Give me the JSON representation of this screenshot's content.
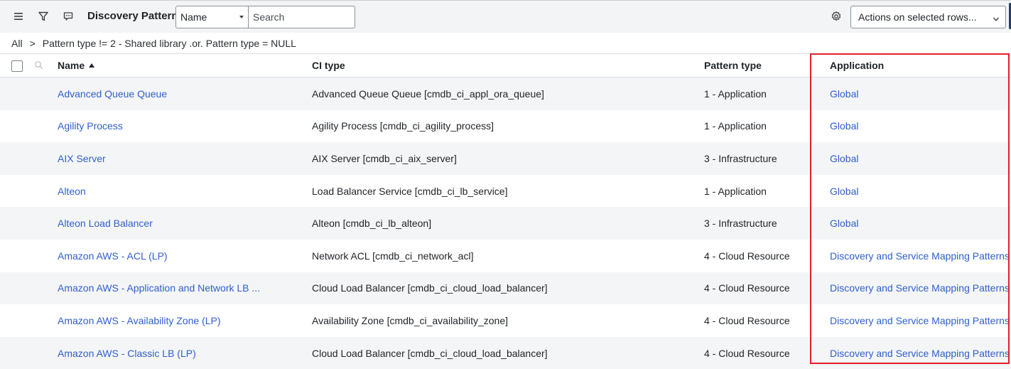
{
  "header": {
    "title": "Discovery Patterns",
    "field_select_value": "Name",
    "search_placeholder": "Search",
    "actions_select_value": "Actions on selected rows...",
    "icons": [
      "menu-icon",
      "filter-icon",
      "comment-icon",
      "gear-icon"
    ]
  },
  "breadcrumb": {
    "root": "All",
    "separator": ">",
    "condition": "Pattern type != 2 - Shared library .or. Pattern type = NULL"
  },
  "columns": {
    "name": "Name",
    "ci_type": "CI type",
    "pattern_type": "Pattern type",
    "application": "Application"
  },
  "rows": [
    {
      "name": "Advanced Queue Queue",
      "ci_type": "Advanced Queue Queue [cmdb_ci_appl_ora_queue]",
      "pattern_type": "1 - Application",
      "application": "Global"
    },
    {
      "name": "Agility Process",
      "ci_type": "Agility Process [cmdb_ci_agility_process]",
      "pattern_type": "1 - Application",
      "application": "Global"
    },
    {
      "name": "AIX Server",
      "ci_type": "AIX Server [cmdb_ci_aix_server]",
      "pattern_type": "3 - Infrastructure",
      "application": "Global"
    },
    {
      "name": "Alteon",
      "ci_type": "Load Balancer Service [cmdb_ci_lb_service]",
      "pattern_type": "1 - Application",
      "application": "Global"
    },
    {
      "name": "Alteon Load Balancer",
      "ci_type": "Alteon [cmdb_ci_lb_alteon]",
      "pattern_type": "3 - Infrastructure",
      "application": "Global"
    },
    {
      "name": "Amazon AWS - ACL (LP)",
      "ci_type": "Network ACL [cmdb_ci_network_acl]",
      "pattern_type": "4 - Cloud Resource",
      "application": "Discovery and Service Mapping Patterns"
    },
    {
      "name": "Amazon AWS - Application and Network LB ...",
      "ci_type": "Cloud Load Balancer [cmdb_ci_cloud_load_balancer]",
      "pattern_type": "4 - Cloud Resource",
      "application": "Discovery and Service Mapping Patterns"
    },
    {
      "name": "Amazon AWS - Availability Zone (LP)",
      "ci_type": "Availability Zone [cmdb_ci_availability_zone]",
      "pattern_type": "4 - Cloud Resource",
      "application": "Discovery and Service Mapping Patterns"
    },
    {
      "name": "Amazon AWS - Classic LB (LP)",
      "ci_type": "Cloud Load Balancer [cmdb_ci_cloud_load_balancer]",
      "pattern_type": "4 - Cloud Resource",
      "application": "Discovery and Service Mapping Patterns"
    }
  ],
  "colors": {
    "link": "#2f5fcf",
    "highlight_border": "#e0202a",
    "header_bg": "#f3f4f5",
    "stripe": "#f4f5f6"
  }
}
